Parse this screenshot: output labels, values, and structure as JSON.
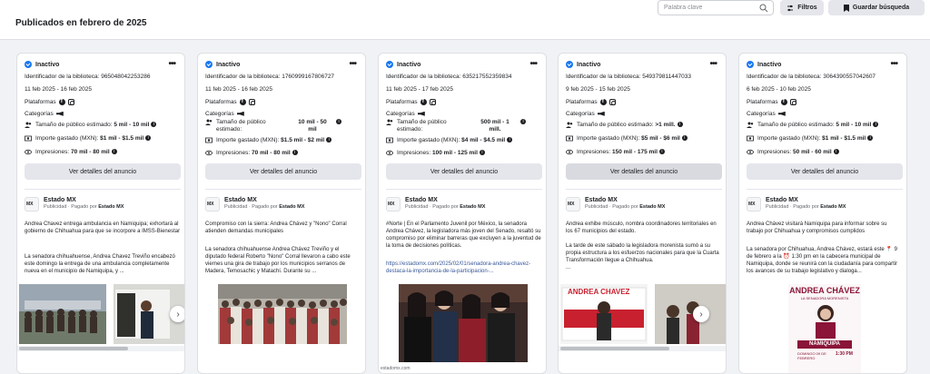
{
  "header": {
    "title": "Publicados en febrero de 2025",
    "search_placeholder": "Palabra clave",
    "filters_label": "Filtros",
    "save_search_label": "Guardar búsqueda"
  },
  "labels": {
    "status": "Inactivo",
    "library_prefix": "Identificador de la biblioteca:",
    "platforms": "Plataformas",
    "categories": "Categorías",
    "audience": "Tamaño de público estimado:",
    "spend": "Importe gastado (MXN):",
    "impressions": "Impresiones:",
    "details": "Ver detalles del anuncio",
    "sponsored": "Publicidad",
    "paid_by": "· Pagado por",
    "advertiser": "Estado MX"
  },
  "colors": {
    "accent": "#1877f2",
    "button_bg": "#e4e6eb"
  },
  "cards": [
    {
      "library_id": "965048042253286",
      "dates": "11 feb 2025 - 16 feb 2025",
      "audience": "5 mil - 10 mil",
      "spend": "$1 mil - $1.5 mil",
      "impressions": "70 mil - 80 mil",
      "payer": "Estado MX",
      "text1": "Andrea Chavez entrega ambulancia en Namiquipa; exhortará al gobierno de Chihuahua para que se incorpore a IMSS-Bienestar",
      "text2": "La senadora chihuahuense, Andrea Chavez Treviño encabezó este domingo la entrega de una ambulancia completamente nueva en el municipio de Namiquipa, y ..."
    },
    {
      "library_id": "1760999167806727",
      "dates": "11 feb 2025 - 16 feb 2025",
      "audience": "10 mil - 50 mil",
      "spend": "$1.5 mil - $2 mil",
      "impressions": "70 mil - 80 mil",
      "payer": "Estado MX",
      "text1": "Compromiso con la sierra: Andrea Chávez y \"Nono\" Corral atienden demandas municipales",
      "text2": "La senadora chihuahuense Andrea Chávez Treviño y el diputado federal Roberto \"Nono\" Corral llevaron a cabo este viernes una gira de trabajo por los municipios serranos de Madera, Temosachic y Matachí. Durante su ..."
    },
    {
      "library_id": "635217552359834",
      "dates": "11 feb 2025 - 17 feb 2025",
      "audience": "500 mil - 1 mill.",
      "spend": "$4 mil - $4.5 mil",
      "impressions": "100 mil - 125 mil",
      "payer": "Estado MX",
      "text1": "#Norte | En el Parlamento Juvenil por México, la senadora Andrea Chávez, la legisladora más joven del Senado, resaltó su compromiso por eliminar barreras que excluyen a la juventud de la toma de decisiones políticas.",
      "link": "https://estadomx.com/2025/02/01/senadora-andrea-chavez-destaca-la-importancia-de-la-participacion-...",
      "caption": "estadomx.com"
    },
    {
      "library_id": "549379811447033",
      "dates": "9 feb 2025 - 15 feb 2025",
      "audience": ">1 mill.",
      "spend": "$5 mil - $6 mil",
      "impressions": "150 mil - 175 mil",
      "payer": "Estado MX",
      "text1": "Andrea exhibe músculo, nombra coordinadores territoriales en los 67 municipios del estado.",
      "text2": "La tarde de este sábado la legisladora morenista sumó a su propia estructura a los esfuerzos nacionales para que la Cuarta Transformación llegue a Chihuahua.",
      "text3": "..."
    },
    {
      "library_id": "3064390557042607",
      "dates": "6 feb 2025 - 10 feb 2025",
      "audience": "5 mil - 10 mil",
      "spend": "$1 mil - $1.5 mil",
      "impressions": "50 mil - 60 mil",
      "payer": "Estado MX",
      "text1": "Andrea Chávez visitará Namiquipa para informar sobre su trabajo por Chihuahua y compromisos cumplidos",
      "text2": "La senadora por Chihuahua, Andrea Chávez, estará este 📍 9 de febrero a la ⏰ 1:30 pm en la cabecera municipal de Namiquipa, donde se reunirá con la ciudadanía para compartir los avances de su trabajo legislativo y dialoga...",
      "poster_title": "ANDREA CHÁVEZ",
      "poster_subtitle": "LA SENADORA MORENISTA",
      "poster_place": "NAMIQUIPA",
      "poster_date": "DOMINGO 09 DE FEBRERO",
      "poster_time": "1:30 PM"
    }
  ],
  "card4_banner": "ANDREA CHAVEZ"
}
